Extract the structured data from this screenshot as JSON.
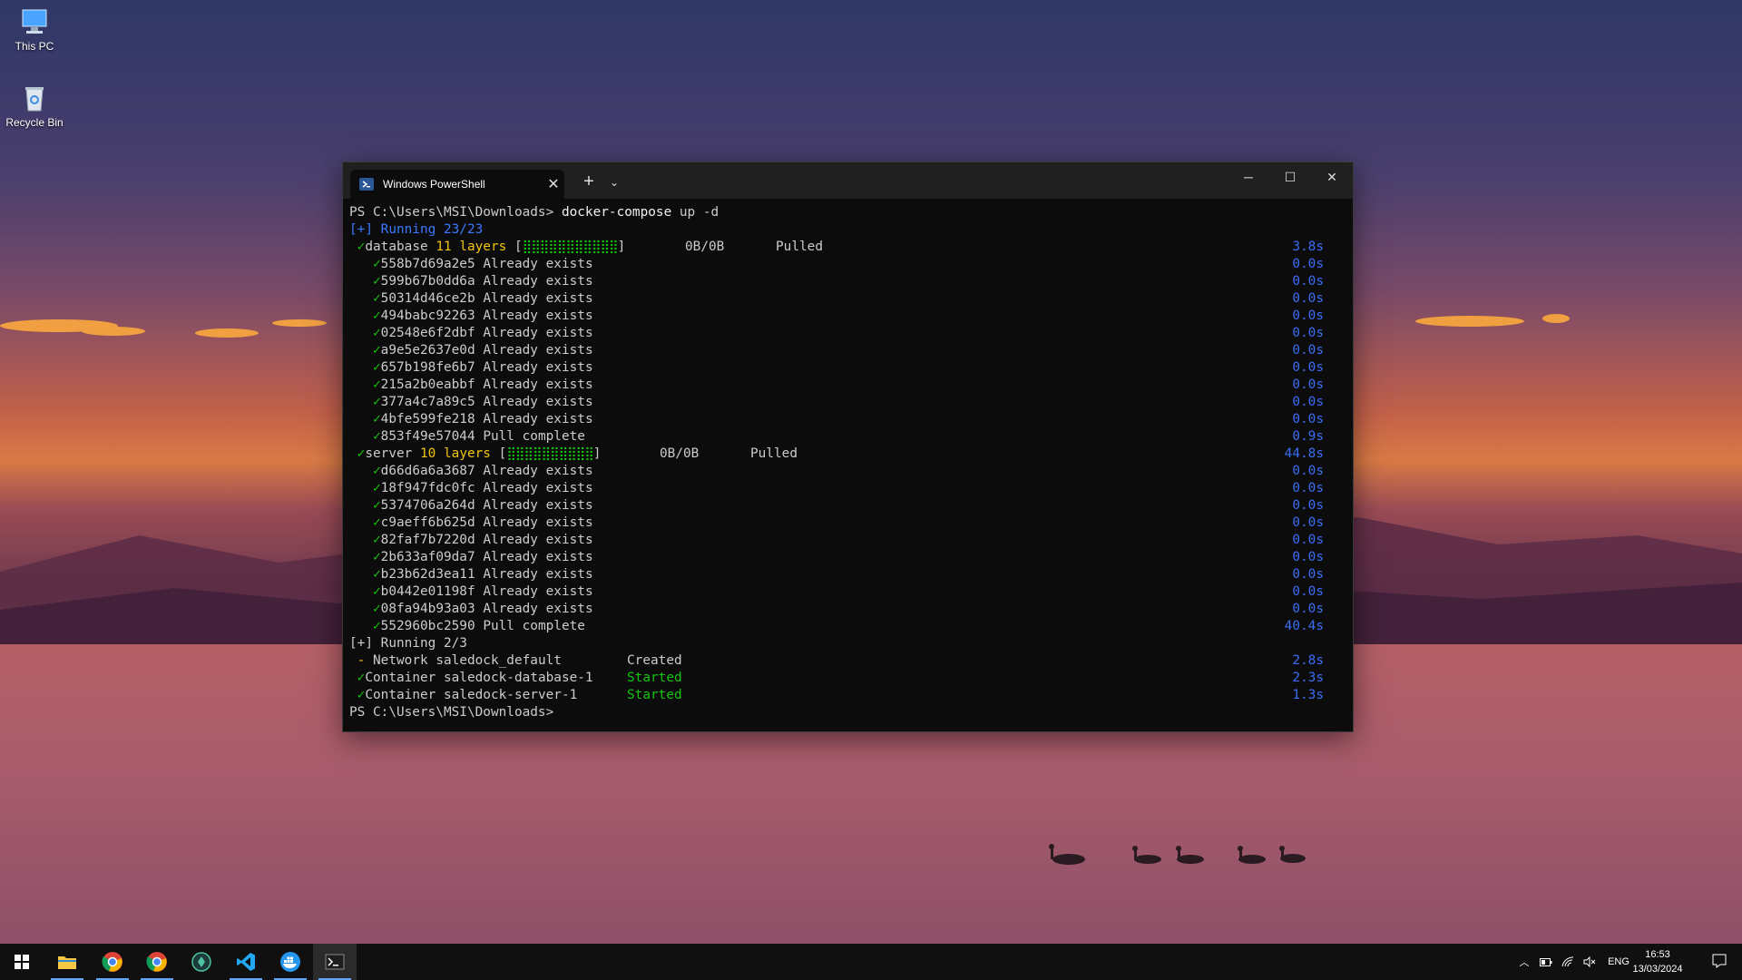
{
  "desktop": {
    "icons": [
      {
        "label": "This PC",
        "icon": "this-pc-icon"
      },
      {
        "label": "Recycle Bin",
        "icon": "recycle-bin-icon"
      }
    ]
  },
  "window": {
    "tab_title": "Windows PowerShell",
    "new_tab": "+",
    "dropdown": "⌄",
    "minimize": "─",
    "maximize": "☐",
    "close": "✕"
  },
  "terminal": {
    "prompt1": "PS C:\\Users\\MSI\\Downloads> ",
    "command": "docker-compose",
    "command_args": " up -d",
    "running1": "[+] Running 23/23",
    "database": {
      "name": "database",
      "layers": "11 layers",
      "bar": "[⣿⣿⣿⣿⣿⣿⣿⣿⣿⣿⣿]",
      "size": "0B/0B",
      "status": "Pulled",
      "dur": "3.8s"
    },
    "db_layers": [
      {
        "id": "558b7d69a2e5",
        "status": "Already exists",
        "dur": "0.0s"
      },
      {
        "id": "599b67b0dd6a",
        "status": "Already exists",
        "dur": "0.0s"
      },
      {
        "id": "50314d46ce2b",
        "status": "Already exists",
        "dur": "0.0s"
      },
      {
        "id": "494babc92263",
        "status": "Already exists",
        "dur": "0.0s"
      },
      {
        "id": "02548e6f2dbf",
        "status": "Already exists",
        "dur": "0.0s"
      },
      {
        "id": "a9e5e2637e0d",
        "status": "Already exists",
        "dur": "0.0s"
      },
      {
        "id": "657b198fe6b7",
        "status": "Already exists",
        "dur": "0.0s"
      },
      {
        "id": "215a2b0eabbf",
        "status": "Already exists",
        "dur": "0.0s"
      },
      {
        "id": "377a4c7a89c5",
        "status": "Already exists",
        "dur": "0.0s"
      },
      {
        "id": "4bfe599fe218",
        "status": "Already exists",
        "dur": "0.0s"
      },
      {
        "id": "853f49e57044",
        "status": "Pull complete",
        "dur": "0.9s"
      }
    ],
    "server": {
      "name": "server",
      "layers": "10 layers",
      "bar": "[⣿⣿⣿⣿⣿⣿⣿⣿⣿⣿]",
      "size": "0B/0B",
      "status": "Pulled",
      "dur": "44.8s"
    },
    "srv_layers": [
      {
        "id": "d66d6a6a3687",
        "status": "Already exists",
        "dur": "0.0s"
      },
      {
        "id": "18f947fdc0fc",
        "status": "Already exists",
        "dur": "0.0s"
      },
      {
        "id": "5374706a264d",
        "status": "Already exists",
        "dur": "0.0s"
      },
      {
        "id": "c9aeff6b625d",
        "status": "Already exists",
        "dur": "0.0s"
      },
      {
        "id": "82faf7b7220d",
        "status": "Already exists",
        "dur": "0.0s"
      },
      {
        "id": "2b633af09da7",
        "status": "Already exists",
        "dur": "0.0s"
      },
      {
        "id": "b23b62d3ea11",
        "status": "Already exists",
        "dur": "0.0s"
      },
      {
        "id": "b0442e01198f",
        "status": "Already exists",
        "dur": "0.0s"
      },
      {
        "id": "08fa94b93a03",
        "status": "Already exists",
        "dur": "0.0s"
      },
      {
        "id": "552960bc2590",
        "status": "Pull complete",
        "dur": "40.4s"
      }
    ],
    "running2": "[+] Running 2/3",
    "network": {
      "mark": "-",
      "text": "Network saledock_default",
      "state": "Created",
      "dur": "2.8s"
    },
    "containers": [
      {
        "text": "Container saledock-database-1",
        "state": "Started",
        "dur": "2.3s"
      },
      {
        "text": "Container saledock-server-1",
        "state": "Started",
        "dur": "1.3s"
      }
    ],
    "prompt2": "PS C:\\Users\\MSI\\Downloads> "
  },
  "taskbar": {
    "apps": [
      "windows-start-icon",
      "file-explorer-icon",
      "chrome-icon",
      "chrome-alt-icon",
      "app-icon",
      "vscode-icon",
      "docker-icon",
      "terminal-icon"
    ],
    "tray": {
      "lang": "ENG",
      "time": "16:53",
      "date": "13/03/2024"
    }
  },
  "colors": {
    "check": "#16c60c",
    "duration": "#3b78ff",
    "layers": "#f1c40f"
  }
}
